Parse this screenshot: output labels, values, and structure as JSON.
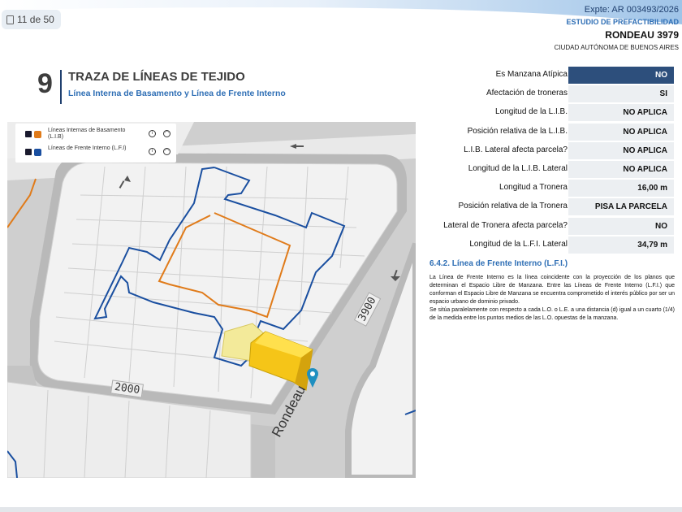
{
  "viewer": {
    "page_indicator": "11 de 50"
  },
  "header": {
    "expediente": "Expte: AR 003493/2026",
    "estudio": "ESTUDIO DE PREFACTIBILIDAD",
    "address": "RONDEAU 3979",
    "city": "CIUDAD AUTÓNOMA DE BUENOS AIRES"
  },
  "section": {
    "number": "9",
    "title": "TRAZA DE LÍNEAS DE TEJIDO",
    "subtitle": "Línea Interna de Basamento y Línea de Frente Interno"
  },
  "map": {
    "legend": [
      {
        "label": "Líneas Internas de Basamento (L.I.B)",
        "color": "#e07b1a"
      },
      {
        "label": "Líneas de Frente Interno (L.F.I)",
        "color": "#1a4fa0"
      }
    ],
    "street_labels": {
      "rondeau": "Rondeau",
      "num_2000": "2000",
      "num_3900": "3900"
    },
    "colors": {
      "lib_line": "#e07b1a",
      "lfi_line": "#1a4fa0",
      "parcel": "#f5c518",
      "marker": "#1e8fc0"
    }
  },
  "table": {
    "rows": [
      {
        "label": "Es Manzana Atípica",
        "value": "NO",
        "highlight": true
      },
      {
        "label": "Afectación de troneras",
        "value": "SI",
        "highlight": false
      },
      {
        "label": "Longitud de la L.I.B.",
        "value": "NO APLICA",
        "highlight": false
      },
      {
        "label": "Posición relativa de la L.I.B.",
        "value": "NO APLICA",
        "highlight": false
      },
      {
        "label": "L.I.B. Lateral afecta parcela?",
        "value": "NO APLICA",
        "highlight": false
      },
      {
        "label": "Longitud de la L.I.B. Lateral",
        "value": "NO APLICA",
        "highlight": false
      },
      {
        "label": "Longitud a Tronera",
        "value": "16,00 m",
        "highlight": false
      },
      {
        "label": "Posición relativa de la Tronera",
        "value": "PISA LA PARCELA",
        "highlight": false
      },
      {
        "label": "Lateral de Tronera afecta parcela?",
        "value": "NO",
        "highlight": false
      },
      {
        "label": "Longitud de la L.F.I. Lateral",
        "value": "34,79 m",
        "highlight": false
      }
    ]
  },
  "lfi_section": {
    "heading": "6.4.2. Línea de Frente Interno (L.F.I.)",
    "paragraph1": "La Línea de Frente Interno es la línea coincidente con la proyección de los planos que determinan el Espacio Libre de Manzana. Entre las Líneas de Frente Interno (L.F.I.) que conforman el Espacio Libre de Manzana se encuentra comprometido el interés público por ser un espacio urbano de dominio privado.",
    "paragraph2": "Se sitúa paralelamente con respecto a cada L.O. o L.E. a una distancia (d) igual a un cuarto (1/4) de la medida entre los puntos medios de las L.O. opuestas de la manzana."
  }
}
